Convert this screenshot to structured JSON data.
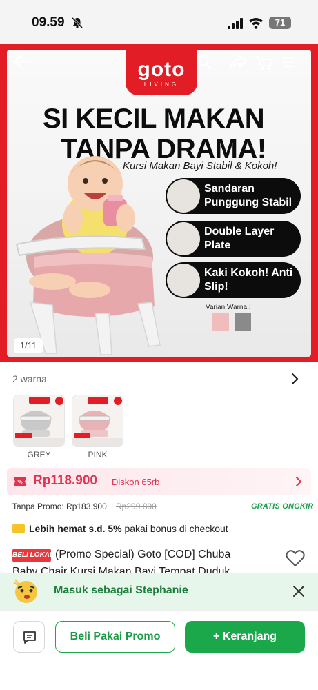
{
  "status_bar": {
    "time": "09.59",
    "battery": "71"
  },
  "hero": {
    "logo": "goto",
    "logo_sub": "LIVING",
    "headline_1": "SI KECIL MAKAN",
    "headline_2": "TANPA DRAMA!",
    "tagline": "Kursi Makan Bayi Stabil & Kokoh!",
    "features": [
      {
        "label": "Sandaran Punggung Stabil"
      },
      {
        "label": "Double Layer Plate"
      },
      {
        "label": "Kaki Kokoh! Anti Slip!"
      }
    ],
    "varian_label": "Varian Warna :",
    "swatch_colors": [
      "#f2bcbc",
      "#8a8a8a"
    ],
    "page_indicator": "1/11"
  },
  "variants": {
    "title": "2 warna",
    "items": [
      {
        "label": "GREY"
      },
      {
        "label": "PINK"
      }
    ]
  },
  "price": {
    "current": "Rp118.900",
    "discount": "Diskon 65rb",
    "no_promo_label": "Tanpa Promo: Rp183.900",
    "original": "Rp299.800",
    "shipping": "GRATIS ONGKIR"
  },
  "bonus": {
    "bold": "Lebih hemat s.d. 5%",
    "rest": " pakai bonus di checkout"
  },
  "product": {
    "badge": "BELI LOKAL",
    "title": "(Promo Special) Goto [COD] Chuba",
    "title_line2": "Baby Chair Kursi Makan Bayi Tempat Duduk"
  },
  "login_banner": {
    "text": "Masuk sebagai Stephanie"
  },
  "bottom_bar": {
    "promo_label": "Beli Pakai Promo",
    "cart_label": "+ Keranjang"
  },
  "colors": {
    "brand_red": "#e31d26",
    "price_red": "#e0334f",
    "green": "#1aa84b"
  }
}
